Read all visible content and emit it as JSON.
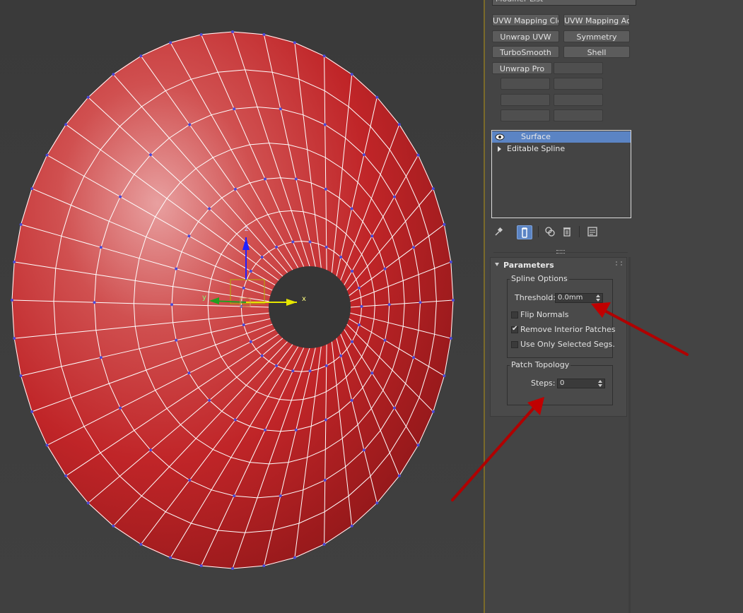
{
  "modifier_list": {
    "label": "Modifier List",
    "buttons": [
      {
        "label": "UVW Mapping Clear"
      },
      {
        "label": "UVW Mapping Add"
      },
      {
        "label": "Unwrap UVW"
      },
      {
        "label": "Symmetry"
      },
      {
        "label": "TurboSmooth"
      },
      {
        "label": "Shell"
      },
      {
        "label": "Unwrap Pro"
      }
    ]
  },
  "stack": {
    "items": [
      {
        "label": "Surface",
        "selected": true,
        "icon": "eye-icon"
      },
      {
        "label": "Editable Spline",
        "selected": false,
        "icon": "expand-triangle-icon"
      }
    ]
  },
  "stack_toolbar": [
    "pin-stack-icon",
    "show-end-result-icon",
    "make-unique-icon",
    "remove-modifier-icon",
    "configure-modifier-sets-icon"
  ],
  "parameters": {
    "title": "Parameters",
    "spline_options": {
      "title": "Spline Options",
      "threshold_label": "Threshold:",
      "threshold_value": "0.0mm",
      "flip_normals": {
        "label": "Flip Normals",
        "checked": false
      },
      "remove_interior_patches": {
        "label": "Remove Interior Patches",
        "checked": true
      },
      "use_only_selected_segs": {
        "label": "Use Only Selected Segs.",
        "checked": false
      }
    },
    "patch_topology": {
      "title": "Patch Topology",
      "steps_label": "Steps:",
      "steps_value": "0"
    }
  },
  "viewport": {
    "gizmo_axes": {
      "x": "x",
      "y": "y",
      "z": "z"
    },
    "mesh_color": "#c8282a",
    "wire_color": "#ffffff",
    "vertex_color": "#4a4ad8",
    "annotation_color": "#c00000"
  }
}
